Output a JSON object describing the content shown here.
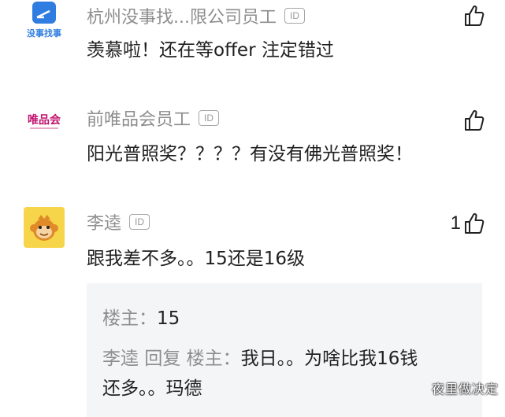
{
  "comments": [
    {
      "name": "杭州没事找...限公司员工",
      "id_badge": "ID",
      "text": "羡慕啦！还在等offer 注定错过",
      "avatar_text": "没事找事",
      "likes": ""
    },
    {
      "name": "前唯品会员工",
      "id_badge": "ID",
      "text": "阳光普照奖？？？？有没有佛光普照奖！",
      "avatar_text": "唯品会",
      "likes": ""
    },
    {
      "name": "李逵",
      "id_badge": "ID",
      "text": "跟我差不多。。15还是16级",
      "avatar_text": "",
      "likes": "1"
    }
  ],
  "replies": [
    {
      "author": "楼主",
      "sep": "：",
      "text": "15"
    },
    {
      "author": "李逵",
      "reply_word": "回复",
      "target": "楼主",
      "sep": "：",
      "text": "我日。。为啥比我16钱",
      "text_cont": "还多。。玛德"
    }
  ],
  "watermark": "夜里做决定",
  "colors": {
    "name_gray": "#8e8e8e",
    "reply_bg": "#f4f5f7",
    "avatar1_blue": "#2f7de1",
    "avatar2_pink": "#c1126f",
    "avatar3_yellow": "#f7d54a"
  },
  "icons": [
    "thumb-up-icon"
  ]
}
